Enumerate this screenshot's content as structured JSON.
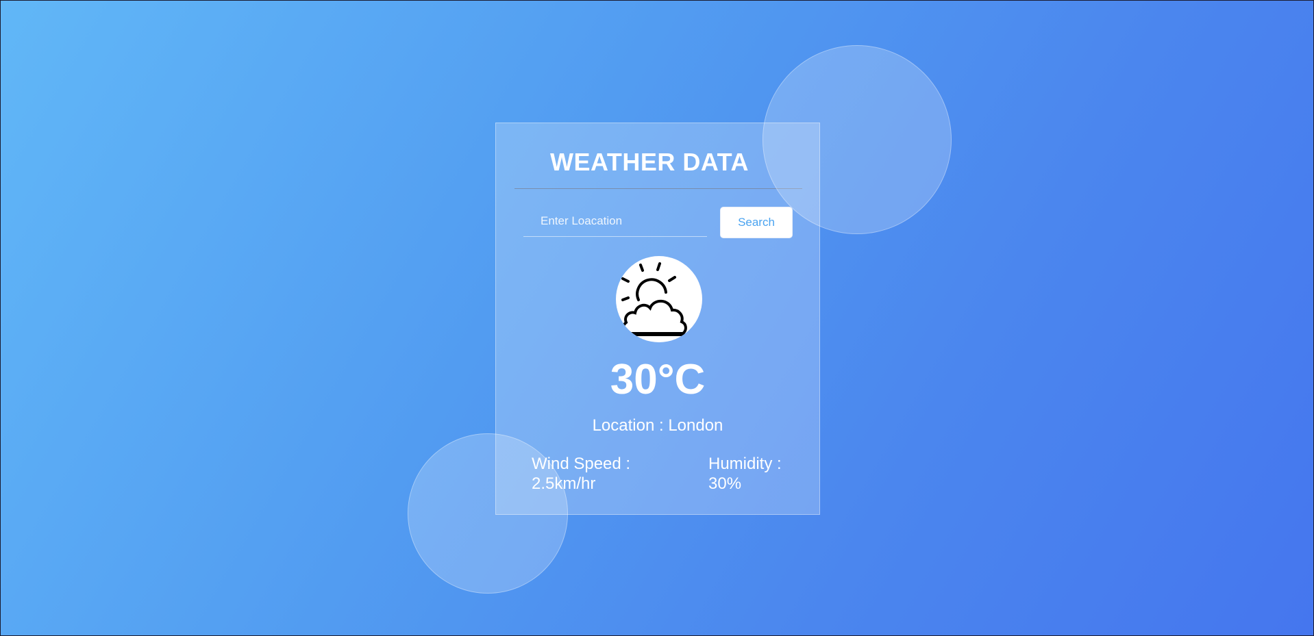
{
  "app": {
    "title": "WEATHER DATA"
  },
  "search": {
    "placeholder": "Enter Loacation",
    "value": "",
    "button_label": "Search"
  },
  "weather": {
    "icon": "partly-cloudy-icon",
    "temperature": "30°C",
    "location_label": "Location : London",
    "wind_speed_label": "Wind Speed :",
    "wind_speed_value": "2.5km/hr",
    "humidity_label": "Humidity :",
    "humidity_value": "30%"
  },
  "colors": {
    "background_start": "#61b7f7",
    "background_end": "#4576ee",
    "button_text": "#4aa3f0",
    "text": "#ffffff"
  }
}
